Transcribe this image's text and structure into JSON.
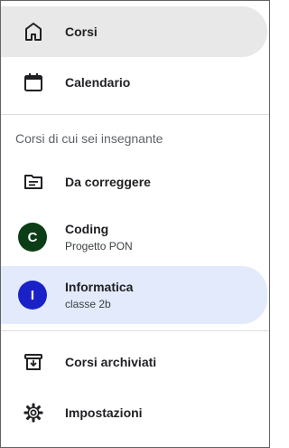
{
  "nav": {
    "courses_label": "Corsi",
    "calendar_label": "Calendario"
  },
  "teaching_section": {
    "title": "Corsi di cui sei insegnante",
    "to_review_label": "Da correggere",
    "courses": [
      {
        "initial": "C",
        "name": "Coding",
        "subtitle": "Progetto PON",
        "avatar_color": "#0b3d17"
      },
      {
        "initial": "I",
        "name": "Informatica",
        "subtitle": "classe 2b",
        "avatar_color": "#1a22c7"
      }
    ]
  },
  "footer": {
    "archived_label": "Corsi archiviati",
    "settings_label": "Impostazioni"
  },
  "colors": {
    "active_gray": "#e8e8e8",
    "active_blue": "#e2eafc",
    "icon": "#202124"
  },
  "icons": {
    "courses": "home-icon",
    "calendar": "calendar-icon",
    "to_review": "folder-list-icon",
    "archived": "archive-icon",
    "settings": "gear-icon"
  }
}
